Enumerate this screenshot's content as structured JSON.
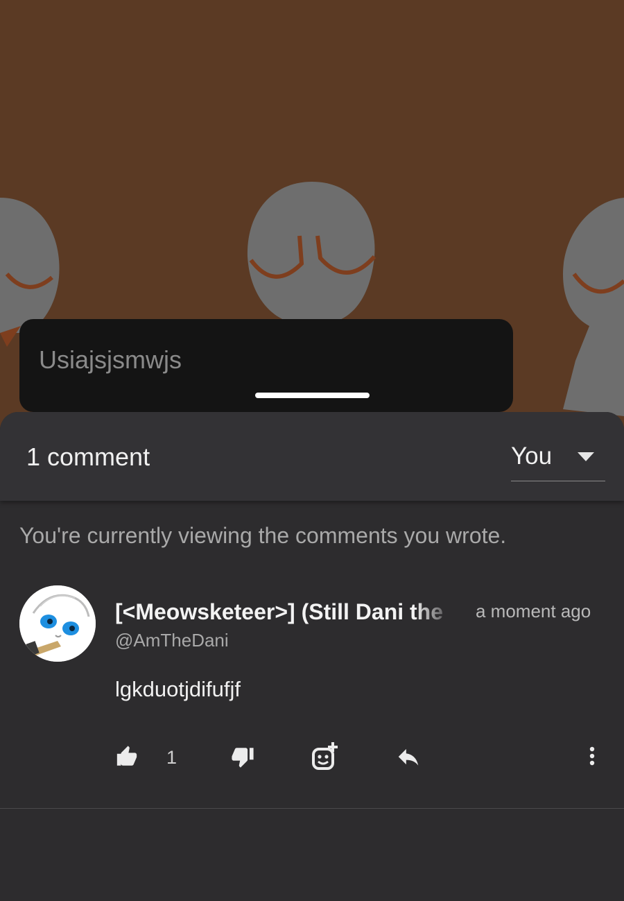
{
  "post": {
    "text": "Usiajsjsmwjs"
  },
  "comments_sheet": {
    "count_label": "1 comment",
    "filter": {
      "selected": "You",
      "icon": "caret-down-icon"
    },
    "notice": "You're currently viewing the comments you wrote.",
    "comment": {
      "author": "[<Meowsketeer>] (Still Dani the",
      "handle": "@AmTheDani",
      "time": "a moment ago",
      "body": "lgkduotjdifufjf",
      "actions": {
        "like_icon": "thumbs-up-icon",
        "like_count": "1",
        "dislike_icon": "thumbs-down-icon",
        "react_icon": "add-reaction-icon",
        "reply_icon": "reply-icon",
        "more_icon": "more-vertical-icon"
      }
    }
  },
  "colors": {
    "scene_background": "#5b3a24",
    "sheet_background": "#2d2c2e",
    "header_background": "#333235"
  }
}
